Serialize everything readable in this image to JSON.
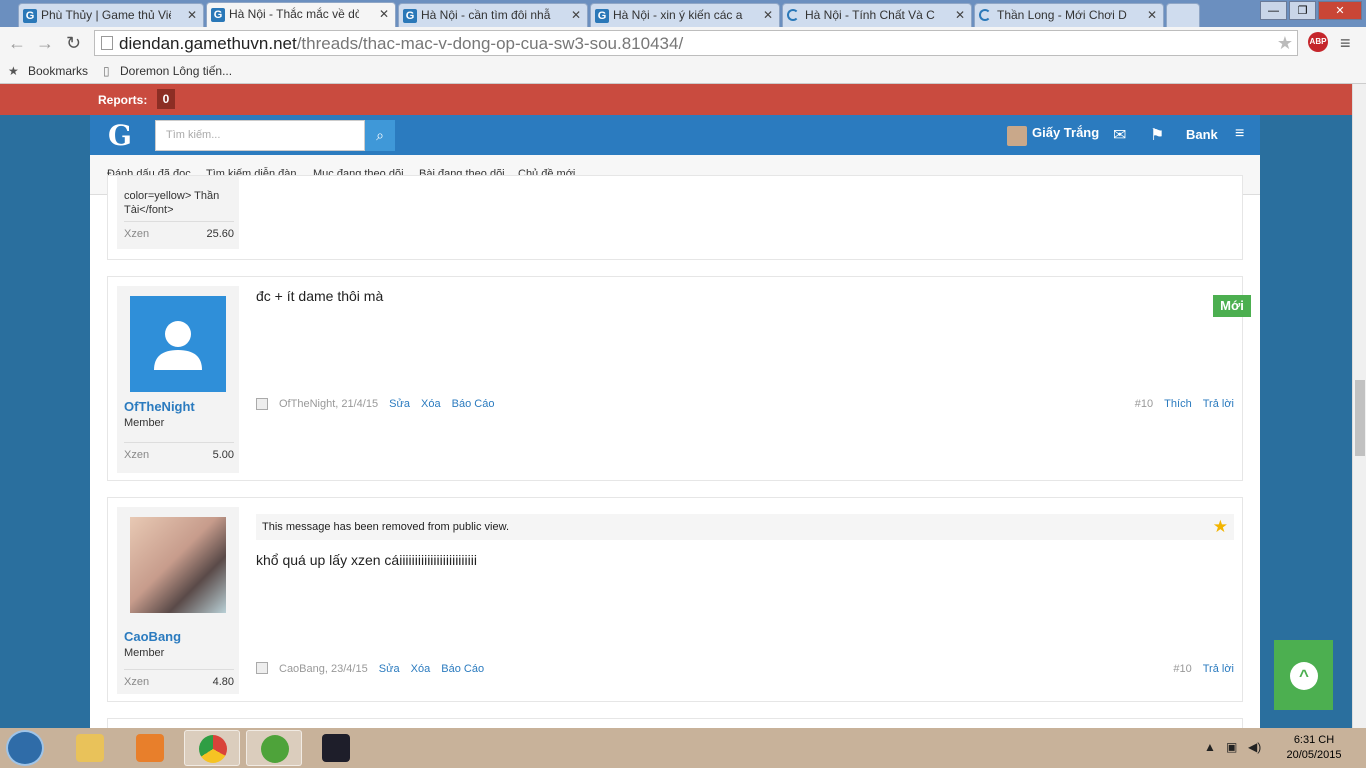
{
  "browser": {
    "tabs": [
      {
        "label": "Phù Thủy | Game thủ Việt",
        "active": false,
        "loading": false
      },
      {
        "label": "Hà Nội - Thắc mắc về dòn",
        "active": true,
        "loading": false
      },
      {
        "label": "Hà Nội - cần tìm đôi nhẫn",
        "active": false,
        "loading": false
      },
      {
        "label": "Hà Nội - xin ý kiến các anh",
        "active": false,
        "loading": false
      },
      {
        "label": "Hà Nội - Tính Chất Và Cấp",
        "active": false,
        "loading": true
      },
      {
        "label": "Thần Long - Mới Chơi DW",
        "active": false,
        "loading": true
      }
    ],
    "url_host": "diendan.gamethuvn.net",
    "url_path": "/threads/thac-mac-v-dong-op-cua-sw3-sou.810434/",
    "abp_label": "ABP",
    "bookmarks_label": "Bookmarks",
    "bookmark_item": "Doremon Lông tiến..."
  },
  "reports": {
    "label": "Reports:",
    "count": "0"
  },
  "header": {
    "logo": "G",
    "search_placeholder": "Tìm kiếm...",
    "user_name": "Giấy Trắng",
    "bank_label": "Bank"
  },
  "subnav": [
    "Đánh dấu đã đọc",
    "Tìm kiếm diễn đàn",
    "Mục đang theo dõi",
    "Bài đang theo dõi",
    "Chủ đề mới"
  ],
  "prev_post": {
    "sig_line1": "color=yellow> Thần",
    "sig_line2": "Tài</font>",
    "stat_label": "Xzen",
    "stat_value": "25.60"
  },
  "posts": [
    {
      "user": "OfTheNight",
      "role": "Member",
      "stat_label": "Xzen",
      "stat_value": "5.00",
      "message": "đc + ít dame thôi mà",
      "meta_author": "OfTheNight, 21/4/15",
      "actions": [
        "Sửa",
        "Xóa",
        "Báo Cáo"
      ],
      "post_number": "#10",
      "right_actions": [
        "Thích",
        "Trả lời"
      ],
      "badge": "Mới"
    },
    {
      "user": "CaoBang",
      "role": "Member",
      "stat_label": "Xzen",
      "stat_value": "4.80",
      "removed_notice": "This message has been removed from public view.",
      "message": "khổ quá up lấy xzen cáiiiiiiiiiiiiiiiiiiiiiiiii",
      "meta_author": "CaoBang, 23/4/15",
      "actions": [
        "Sửa",
        "Xóa",
        "Báo Cáo"
      ],
      "post_number": "#10",
      "right_actions": [
        "Trả lời"
      ]
    }
  ],
  "taskbar": {
    "time": "6:31 CH",
    "date": "20/05/2015"
  },
  "colors": {
    "accent": "#2b7bbf",
    "reports_bar": "#c94b3f",
    "new_badge": "#4caf50"
  }
}
